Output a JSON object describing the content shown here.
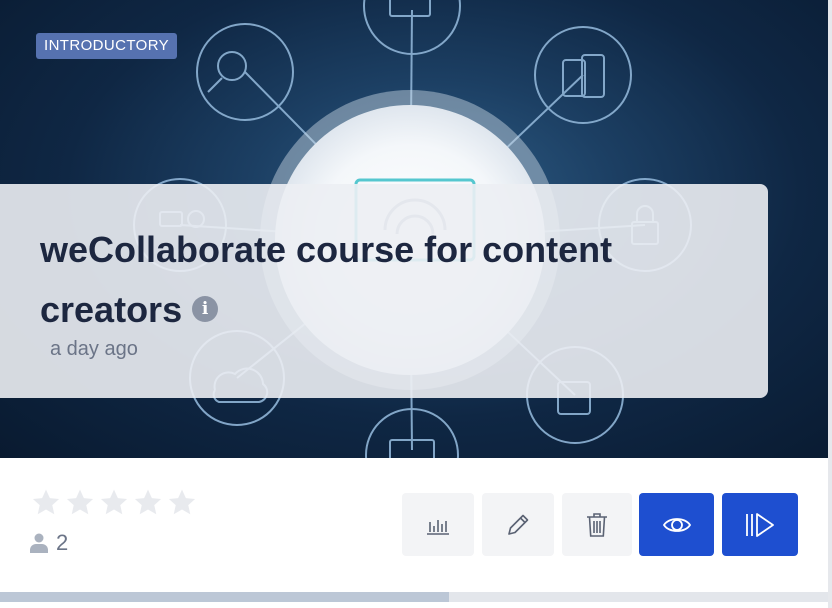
{
  "card": {
    "badge": "INTRODUCTORY",
    "title": "weCollaborate course for content creators",
    "time_ago": "a day ago",
    "rating": 0,
    "rating_max": 5,
    "enrolled_count": "2",
    "progress": 0.54
  },
  "icons": {
    "info": "info-icon",
    "user": "user-icon",
    "star": "star-icon",
    "stats": "bar-chart-icon",
    "edit": "pencil-icon",
    "delete": "trash-icon",
    "view": "eye-icon",
    "start": "play-start-icon"
  },
  "colors": {
    "primary": "#1e4fd0",
    "badge": "#5672b0",
    "title": "#1d2740",
    "muted": "#6b7487",
    "star_empty": "#e8eaee"
  }
}
